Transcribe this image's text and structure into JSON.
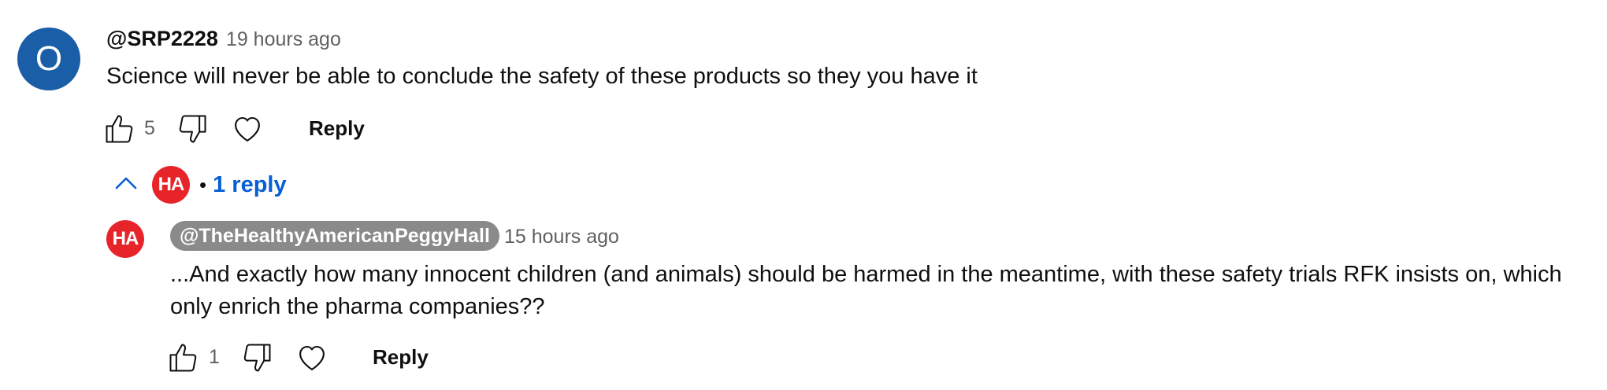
{
  "comment": {
    "avatar_letter": "O",
    "author": "@SRP2228",
    "time": "19 hours ago",
    "text": "Science will never be able to conclude the safety of these products so they you have it",
    "likes": "5",
    "reply_label": "Reply",
    "colors": {
      "avatar_bg": "#1a5ea8"
    }
  },
  "replies_toggle": {
    "separator": "•",
    "label": "1 reply",
    "expanded": true,
    "avatar_logo": "HA",
    "color": "#065fd4"
  },
  "reply": {
    "avatar_logo": "HA",
    "author": "@TheHealthyAmericanPeggyHall",
    "time": "15 hours ago",
    "text": "...And exactly how many innocent children (and animals) should be harmed in the meantime, with these safety trials RFK insists on, which only enrich the pharma companies??",
    "likes": "1",
    "reply_label": "Reply",
    "colors": {
      "avatar_bg": "#e8242b",
      "author_pill_bg": "#8a8a8a"
    }
  },
  "icons": {
    "like": "thumb-up-icon",
    "dislike": "thumb-down-icon",
    "heart": "heart-icon",
    "collapse": "chevron-up-icon"
  }
}
